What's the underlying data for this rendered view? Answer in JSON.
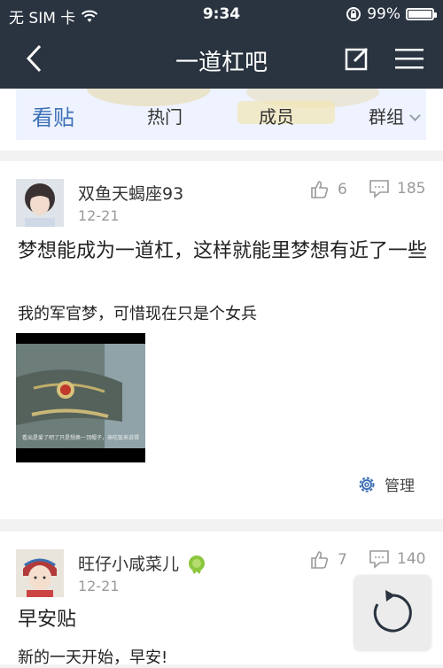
{
  "status_bar": {
    "carrier": "无 SIM 卡",
    "time": "9:34",
    "battery": "99%",
    "battery_level": 0.99
  },
  "nav": {
    "title": "一道杠吧"
  },
  "tabs": [
    {
      "label": "看贴"
    },
    {
      "label": "热门"
    },
    {
      "label": "成员"
    },
    {
      "label": "群组"
    }
  ],
  "posts": [
    {
      "username": "双鱼天蝎座93",
      "date": "12-21",
      "likes": "6",
      "comments": "185",
      "title": "梦想能成为一道杠，这样就能里梦想有近了一些",
      "body": "我的军官梦，可惜现在只是个女兵",
      "image_caption": "看出是爱了吧了只是想换一顶帽子，来吃饭来说得",
      "manage_label": "管理"
    },
    {
      "username": "旺仔小咸菜儿",
      "date": "12-21",
      "likes": "7",
      "comments": "140",
      "title": "早安贴",
      "body": "新的一天开始，早安!"
    }
  ],
  "colors": {
    "nav_bg": "#2a3440",
    "accent": "#3d6fb6",
    "muted": "#9a9a9a"
  }
}
